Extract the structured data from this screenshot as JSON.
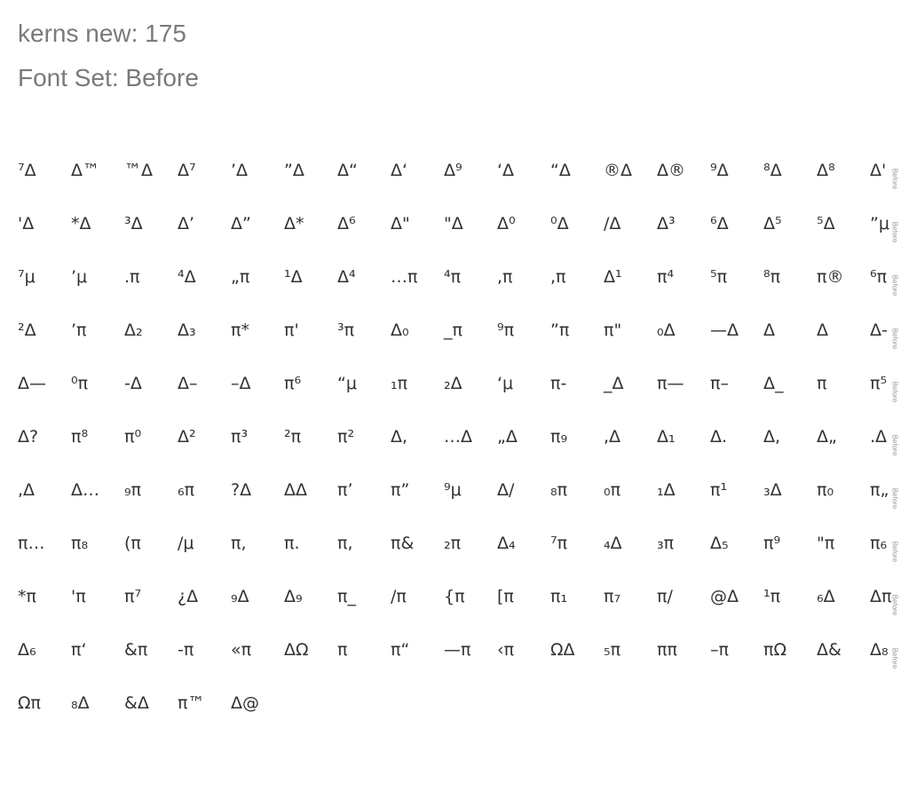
{
  "header": {
    "line1": "kerns new: 175",
    "line2": "Font Set: Before"
  },
  "set_label": "Before",
  "rows": [
    [
      "⁷Δ",
      "Δ™",
      "™Δ",
      "Δ⁷",
      "’Δ",
      "”Δ",
      "Δ“",
      "Δ‘",
      "Δ⁹",
      "‘Δ",
      "“Δ",
      "®Δ",
      "Δ®",
      "⁹Δ",
      "⁸Δ",
      "Δ⁸",
      "Δ'"
    ],
    [
      "'Δ",
      "*Δ",
      "³Δ",
      "Δ’",
      "Δ”",
      "Δ*",
      "Δ⁶",
      "Δ\"",
      "\"Δ",
      "Δ⁰",
      "⁰Δ",
      "/Δ",
      "Δ³",
      "⁶Δ",
      "Δ⁵",
      "⁵Δ",
      "”μ"
    ],
    [
      "⁷μ",
      "’μ",
      ".π",
      "⁴Δ",
      "„π",
      "¹Δ",
      "Δ⁴",
      "…π",
      "⁴π",
      ",π",
      ",π",
      "Δ¹",
      "π⁴",
      "⁵π",
      "⁸π",
      "π®",
      "⁶π"
    ],
    [
      "²Δ",
      "’π",
      "Δ₂",
      "Δ₃",
      "π*",
      "π'",
      "³π",
      "Δ₀",
      "_π",
      "⁹π",
      "”π",
      "π\"",
      "₀Δ",
      "—Δ",
      "Δ",
      "Δ",
      "Δ-"
    ],
    [
      "Δ—",
      "⁰π",
      "-Δ",
      "Δ–",
      "–Δ",
      "π⁶",
      "“μ",
      "₁π",
      "₂Δ",
      "‘μ",
      "π-",
      "_Δ",
      "π—",
      "π–",
      "Δ_",
      "π",
      "π⁵"
    ],
    [
      "Δ?",
      "π⁸",
      "π⁰",
      "Δ²",
      "π³",
      "²π",
      "π²",
      "Δ,",
      "…Δ",
      "„Δ",
      "π₉",
      ",Δ",
      "Δ₁",
      "Δ.",
      "Δ,",
      "Δ„",
      ".Δ"
    ],
    [
      ",Δ",
      "Δ…",
      "₉π",
      "₆π",
      "?Δ",
      "ΔΔ",
      "π’",
      "π”",
      "⁹μ",
      "Δ/",
      "₈π",
      "₀π",
      "₁Δ",
      "π¹",
      "₃Δ",
      "π₀",
      "π„"
    ],
    [
      "π…",
      "π₈",
      "(π",
      "/μ",
      "π,",
      "π.",
      "π,",
      "π&",
      "₂π",
      "Δ₄",
      "⁷π",
      "₄Δ",
      "₃π",
      "Δ₅",
      "π⁹",
      "\"π",
      "π₆"
    ],
    [
      "*π",
      "'π",
      "π⁷",
      "¿Δ",
      "₉Δ",
      "Δ₉",
      "π_",
      "/π",
      "{π",
      "[π",
      "π₁",
      "π₇",
      "π/",
      "@Δ",
      "¹π",
      "₆Δ",
      "Δπ"
    ],
    [
      "Δ₆",
      "π‘",
      "&π",
      "-π",
      "«π",
      "ΔΩ",
      "π",
      "π“",
      "—π",
      "‹π",
      "ΩΔ",
      "₅π",
      "ππ",
      "–π",
      "πΩ",
      "Δ&",
      "Δ₈"
    ],
    [
      "Ωπ",
      "₈Δ",
      "&Δ",
      "π™",
      "Δ@"
    ]
  ]
}
